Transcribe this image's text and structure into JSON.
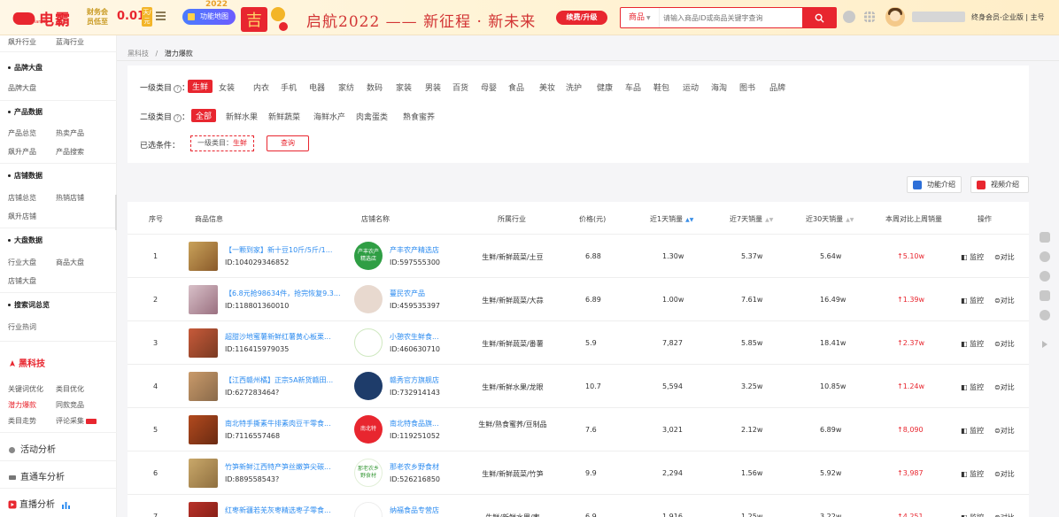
{
  "topbar": {
    "logo_text": "电霸",
    "logo_sub": "Dian Ba",
    "member_line1": "财务会",
    "member_line2": "员低至",
    "price": "0.01",
    "day_label": "天/元",
    "func_label": "功能地图",
    "year_small": "2022",
    "slogan": "启航2022 —— 新征程 · 新未来",
    "upgrade_label": "续费/升级",
    "search_type": "商品",
    "search_placeholder": "请输入商品ID或商品关键字查询",
    "member_text": "终身会员-企业版 | 主号"
  },
  "sidebar": {
    "top_row": [
      "飙升行业",
      "蓝海行业"
    ],
    "sections": [
      {
        "title": "品牌大盘",
        "rows": [
          [
            "品牌大盘"
          ]
        ]
      },
      {
        "title": "产品数据",
        "rows": [
          [
            "产品总览",
            "热卖产品"
          ],
          [
            "飙升产品",
            "产品搜索"
          ]
        ]
      },
      {
        "title": "店铺数据",
        "rows": [
          [
            "店铺总览",
            "热销店铺"
          ],
          [
            "飙升店铺"
          ]
        ]
      },
      {
        "title": "大盘数据",
        "rows": [
          [
            "行业大盘",
            "商品大盘"
          ],
          [
            "店铺大盘"
          ]
        ]
      },
      {
        "title": "搜索词总览",
        "rows": [
          [
            "行业热词"
          ]
        ]
      }
    ],
    "brand": "黑科技",
    "brand_rows": [
      [
        "关键词优化",
        "类目优化"
      ],
      [
        "潜力爆款",
        "同款竞品"
      ],
      [
        "类目走势",
        "评论采集"
      ]
    ],
    "big_items": [
      "活动分析",
      "直通车分析",
      "直播分析"
    ]
  },
  "breadcrumb": {
    "root": "黑科技",
    "sep": "/",
    "current": "潜力爆款"
  },
  "filter": {
    "level1_label": "一级类目",
    "level1": [
      "生鲜",
      "女装",
      "内衣",
      "手机",
      "电器",
      "家纺",
      "数码",
      "家装",
      "男装",
      "百货",
      "母婴",
      "食品",
      "美妆",
      "洗护",
      "健康",
      "车品",
      "鞋包",
      "运动",
      "海淘",
      "图书",
      "品牌"
    ],
    "level2_label": "二级类目",
    "level2": [
      "全部",
      "新鲜水果",
      "新鲜蔬菜",
      "海鲜水产",
      "肉禽蛋类",
      "熟食蜜荞"
    ],
    "selected_label": "已选条件：",
    "cond_key": "一级类目：",
    "cond_val": "生鲜",
    "query": "查询"
  },
  "intro": {
    "func": "功能介绍",
    "video": "视频介绍"
  },
  "table": {
    "headers": {
      "seq": "序号",
      "product": "商品信息",
      "store": "店铺名称",
      "industry": "所属行业",
      "price": "价格(元)",
      "d1": "近1天销量",
      "d7": "近7天销量",
      "d30": "近30天销量",
      "wow": "本周对比上周销量",
      "op": "操作"
    },
    "rows": [
      {
        "seq": "1",
        "name": "【一颗到家】新十豆10斤/5斤/1...",
        "id": "ID:104029346852",
        "store": "产丰农产精选店",
        "store_logo": "产丰农产精选店",
        "store_id": "ID:597555300",
        "industry": "生鲜/新鲜蔬菜/土豆",
        "price": "6.88",
        "d1": "1.30w",
        "d7": "5.37w",
        "d30": "5.64w",
        "wow": "↑5.10w"
      },
      {
        "seq": "2",
        "name": "【6.8元抢98634件，抢完恢复9.3...",
        "id": "ID:118801360010",
        "store": "蔓民农产品",
        "store_logo": "",
        "store_id": "ID:459535397",
        "industry": "生鲜/新鲜蔬菜/大蒜",
        "price": "6.89",
        "d1": "1.00w",
        "d7": "7.61w",
        "d30": "16.49w",
        "wow": "↑1.39w"
      },
      {
        "seq": "3",
        "name": "超甜沙地蜜薯新鲜红薯黄心板栗...",
        "id": "ID:116415979035",
        "store": "小憩农生鲜食...",
        "store_logo": "",
        "store_id": "ID:460630710",
        "industry": "生鲜/新鲜蔬菜/番薯",
        "price": "5.9",
        "d1": "7,827",
        "d7": "5.85w",
        "d30": "18.41w",
        "wow": "↑2.37w"
      },
      {
        "seq": "4",
        "name": "【江西赣州橘】正宗5A新货赣田...",
        "id": "ID:627283464?",
        "store": "赣秀官方旗舰店",
        "store_logo": "",
        "store_id": "ID:732914143",
        "industry": "生鲜/新鲜水果/龙眼",
        "price": "10.7",
        "d1": "5,594",
        "d7": "3.25w",
        "d30": "10.85w",
        "wow": "↑1.24w"
      },
      {
        "seq": "5",
        "name": "南北特手撕素牛排素肉豆干零食...",
        "id": "ID:7116557468",
        "store": "南北特食品旗...",
        "store_logo": "南北特",
        "store_id": "ID:119251052",
        "industry": "生鲜/熟食蜜荞/豆制品",
        "price": "7.6",
        "d1": "3,021",
        "d7": "2.12w",
        "d30": "6.89w",
        "wow": "↑8,090"
      },
      {
        "seq": "6",
        "name": "竹笋新鲜江西特产笋丝嫩笋尖碳...",
        "id": "ID:889558543?",
        "store": "那老农乡野食材",
        "store_logo": "那老农乡野食材",
        "store_id": "ID:526216850",
        "industry": "生鲜/新鲜蔬菜/竹笋",
        "price": "9.9",
        "d1": "2,294",
        "d7": "1.56w",
        "d30": "5.92w",
        "wow": "↑3,987"
      },
      {
        "seq": "7",
        "name": "红枣新疆若羌灰枣精选枣子零食...",
        "id": "",
        "store": "纳福食品专营店",
        "store_logo": "",
        "store_id": "",
        "industry": "生鲜/新鲜水果/枣",
        "price": "6.9",
        "d1": "1,916",
        "d7": "1.25w",
        "d30": "3.22w",
        "wow": "↑4,251"
      }
    ],
    "op_monitor": "监控",
    "op_compare": "对比"
  },
  "colors": {
    "brand": "#e8262f",
    "link": "#2d8cf0",
    "gold": "#c99a23"
  }
}
